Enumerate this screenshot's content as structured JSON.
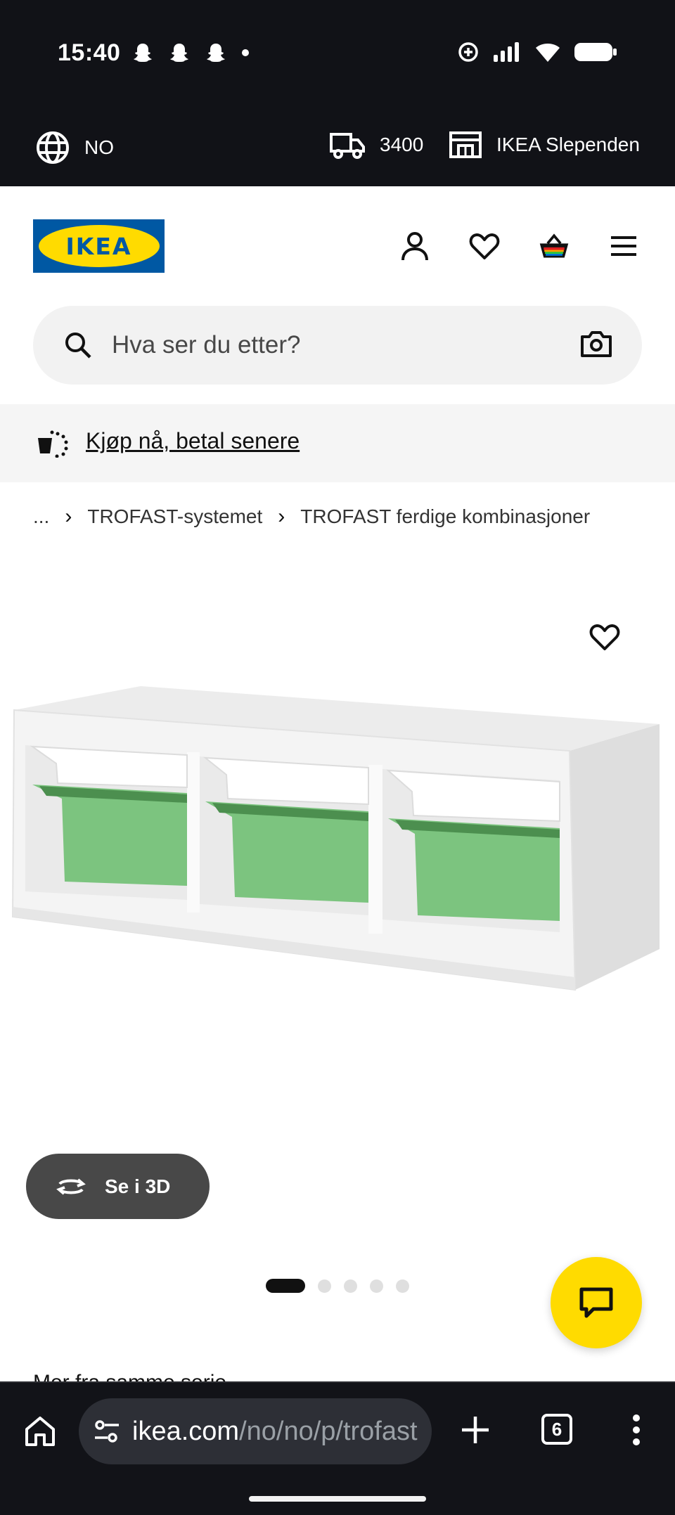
{
  "status_bar": {
    "time": "15:40",
    "left_icons": [
      "snapchat-icon",
      "snapchat-icon",
      "snapchat-icon",
      "dot-icon"
    ],
    "right_icons": [
      "data-saver-icon",
      "signal-icon",
      "wifi-icon",
      "battery-icon"
    ]
  },
  "topbar": {
    "language": "NO",
    "postal_code": "3400",
    "store": "IKEA Slependen"
  },
  "header": {
    "logo_text": "IKEA",
    "icons": [
      "account-icon",
      "wishlist-heart-icon",
      "shopping-bag-icon",
      "menu-hamburger-icon"
    ]
  },
  "search": {
    "placeholder": "Hva ser du etter?"
  },
  "promo": {
    "link_text": "Kjøp nå, betal senere"
  },
  "breadcrumb": {
    "items": [
      "...",
      "TROFAST-systemet",
      "TROFAST ferdige kombinasjoner"
    ]
  },
  "product": {
    "view_3d_label": "Se i 3D",
    "carousel": {
      "total": 5,
      "active": 1
    },
    "partial_text": "Mer fra samme serie"
  },
  "browser": {
    "url_host": "ikea.com",
    "url_path": "/no/no/p/trofast",
    "tab_count": "6"
  },
  "colors": {
    "ikea_blue": "#0058a3",
    "ikea_yellow": "#ffdb00",
    "bin_green": "#7cc47f",
    "dark_bar": "#111217"
  }
}
